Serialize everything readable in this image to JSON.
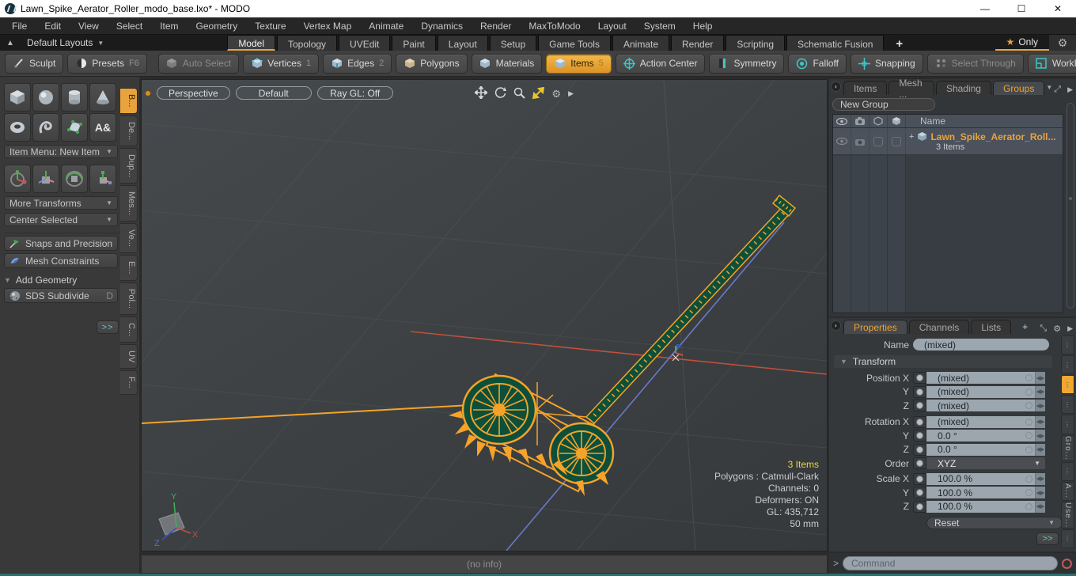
{
  "title_bar": {
    "title": "Lawn_Spike_Aerator_Roller_modo_base.lxo* - MODO",
    "minimize": "—",
    "maximize": "☐",
    "close": "✕"
  },
  "menubar": {
    "items": [
      "File",
      "Edit",
      "View",
      "Select",
      "Item",
      "Geometry",
      "Texture",
      "Vertex Map",
      "Animate",
      "Dynamics",
      "Render",
      "MaxToModo",
      "Layout",
      "System",
      "Help"
    ]
  },
  "layout_bar": {
    "default_layouts": "Default Layouts",
    "tabs": [
      "Model",
      "Topology",
      "UVEdit",
      "Paint",
      "Layout",
      "Setup",
      "Game Tools",
      "Animate",
      "Render",
      "Scripting",
      "Schematic Fusion"
    ],
    "plus": "+",
    "star": "★",
    "only": "Only",
    "gear": "⚙"
  },
  "toolbar": {
    "sculpt": "Sculpt",
    "presets": "Presets",
    "presets_key": "F6",
    "auto_select": "Auto Select",
    "vertices": "Vertices",
    "vertices_key": "1",
    "edges": "Edges",
    "edges_key": "2",
    "polygons": "Polygons",
    "materials": "Materials",
    "items": "Items",
    "items_key": "5",
    "action_center": "Action Center",
    "symmetry": "Symmetry",
    "falloff": "Falloff",
    "snapping": "Snapping",
    "select_through": "Select Through",
    "workplane": "WorkPlane"
  },
  "sidebar": {
    "item_menu": "Item Menu: New Item",
    "more_transforms": "More Transforms",
    "center_selected": "Center Selected",
    "snaps": "Snaps and Precision",
    "mesh_constraints": "Mesh Constraints",
    "add_geometry": "Add Geometry",
    "sds_subdivide": "SDS Subdivide",
    "sds_key": "D",
    "more": ">>",
    "text_tool": "A&",
    "tabs": [
      "B...",
      "De...",
      "Dup...",
      "Mes...",
      "Ve...",
      "E...",
      "Pol...",
      "C...",
      "UV",
      "F..."
    ]
  },
  "viewport": {
    "perspective": "Perspective",
    "style": "Default",
    "raygl": "Ray GL: Off",
    "info": {
      "items": "3 Items",
      "polygons": "Polygons : Catmull-Clark",
      "channels": "Channels: 0",
      "deformers": "Deformers: ON",
      "gl": "GL: 435,712",
      "scale": "50 mm"
    },
    "axis_x": "X",
    "axis_y": "Y",
    "axis_z": "Z",
    "status": "(no info)"
  },
  "groups_panel": {
    "tabs": [
      "Items",
      "Mesh ...",
      "Shading",
      "Groups"
    ],
    "new_group": "New Group",
    "name_header": "Name",
    "item_plus": "+",
    "item_name": "Lawn_Spike_Aerator_Roll...",
    "item_count": "3 Items"
  },
  "properties_panel": {
    "tabs": [
      "Properties",
      "Channels",
      "Lists"
    ],
    "plus": "+",
    "name_label": "Name",
    "name_value": "(mixed)",
    "transform": "Transform",
    "rows": [
      {
        "label": "Position X",
        "value": "(mixed)"
      },
      {
        "label": "Y",
        "value": "(mixed)"
      },
      {
        "label": "Z",
        "value": "(mixed)"
      },
      {
        "label": "Rotation X",
        "value": "(mixed)"
      },
      {
        "label": "Y",
        "value": "0.0 °"
      },
      {
        "label": "Z",
        "value": "0.0 °"
      },
      {
        "label": "Order",
        "value": "XYZ"
      },
      {
        "label": "Scale X",
        "value": "100.0 %"
      },
      {
        "label": "Y",
        "value": "100.0 %"
      },
      {
        "label": "Z",
        "value": "100.0 %"
      }
    ],
    "reset": "Reset",
    "more": ">>",
    "side_tabs": [
      "Gro...",
      "A...",
      "Use..."
    ]
  },
  "command_bar": {
    "prompt": ">",
    "placeholder": "Command"
  },
  "colors": {
    "accent": "#e8a33d",
    "wireframe": "#f5a329",
    "faces": "#0e4f3a",
    "axis_x": "#c0503c",
    "axis_z": "#6a79c8",
    "teal_icons": "#3fc6c6",
    "bottom_line": "#2a6f6f"
  }
}
